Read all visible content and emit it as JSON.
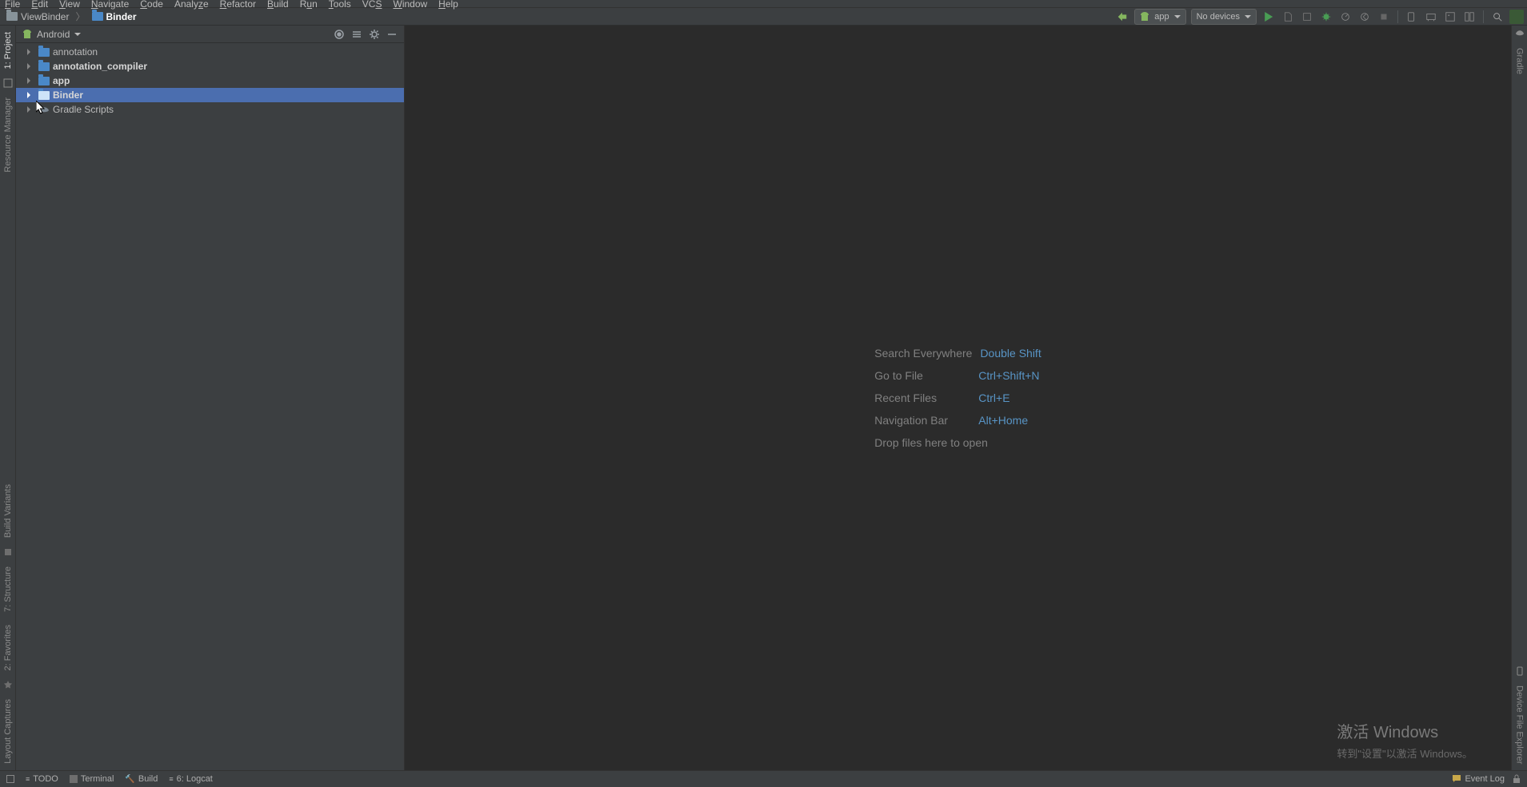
{
  "menubar": {
    "items": [
      "File",
      "Edit",
      "View",
      "Navigate",
      "Code",
      "Analyze",
      "Refactor",
      "Build",
      "Run",
      "Tools",
      "VCS",
      "Window",
      "Help"
    ]
  },
  "breadcrumbs": {
    "root": "ViewBinder",
    "current": "Binder"
  },
  "toolbar": {
    "module": "app",
    "devices": "No devices"
  },
  "project": {
    "view_mode": "Android",
    "items": [
      {
        "label": "annotation",
        "bold": false
      },
      {
        "label": "annotation_compiler",
        "bold": true
      },
      {
        "label": "app",
        "bold": true
      },
      {
        "label": "Binder",
        "bold": true,
        "selected": true
      },
      {
        "label": "Gradle Scripts",
        "bold": false,
        "gradle": true
      }
    ]
  },
  "help": {
    "rows": [
      {
        "label": "Search Everywhere",
        "key": "Double Shift"
      },
      {
        "label": "Go to File",
        "key": "Ctrl+Shift+N"
      },
      {
        "label": "Recent Files",
        "key": "Ctrl+E"
      },
      {
        "label": "Navigation Bar",
        "key": "Alt+Home"
      }
    ],
    "drop": "Drop files here to open"
  },
  "left_gutter": {
    "top": [
      "1: Project"
    ],
    "mid": [
      "Resource Manager"
    ],
    "bot": [
      "Layout Captures",
      "2: Favorites",
      "7: Structure",
      "Build Variants"
    ]
  },
  "right_gutter": {
    "top": [
      "Gradle"
    ],
    "bot": [
      "Device File Explorer"
    ]
  },
  "statusbar": {
    "items": [
      "TODO",
      "Terminal",
      "Build",
      "6: Logcat"
    ],
    "event_log": "Event Log"
  },
  "activate": {
    "t1": "激活 Windows",
    "t2": "转到\"设置\"以激活 Windows。"
  }
}
